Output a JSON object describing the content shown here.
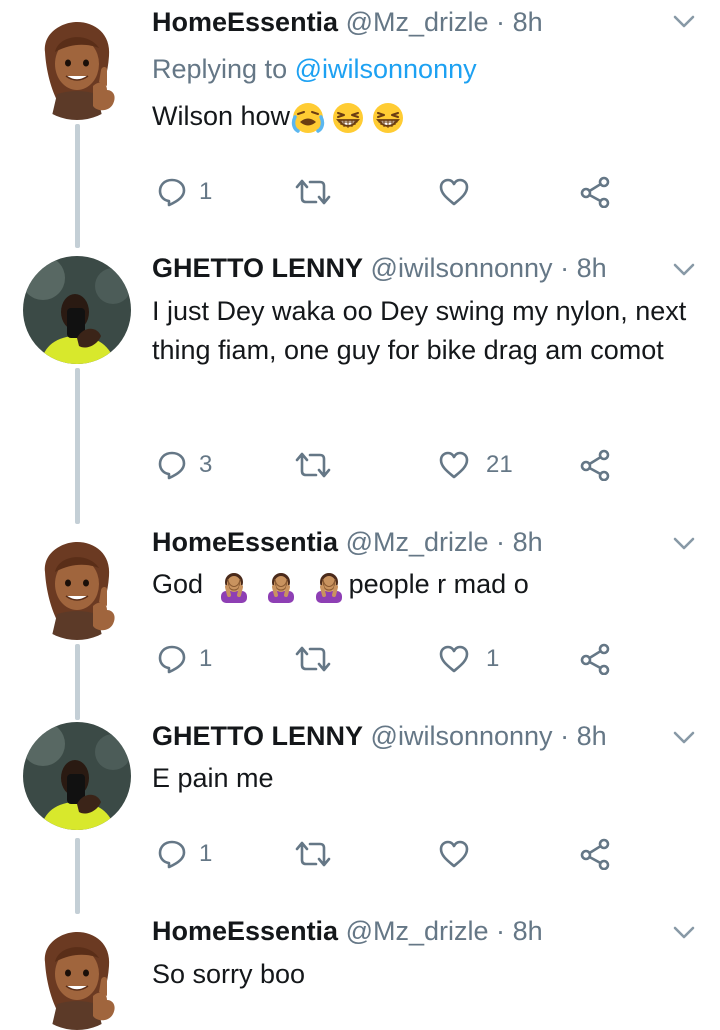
{
  "tweets": [
    {
      "name": "HomeEssentia",
      "handle": "@Mz_drizle",
      "separator": "·",
      "time": "8h",
      "reply_prefix": "Replying to",
      "reply_mention": "@iwilsonnonny",
      "text": "Wilson how",
      "emojis": [
        "tears-of-joy-crying-emoji",
        "grinning-squint-emoji",
        "grinning-squint-emoji"
      ],
      "reply_count": "1",
      "retweet_count": "",
      "like_count": ""
    },
    {
      "name": "GHETTO LENNY",
      "handle": "@iwilsonnonny",
      "separator": "·",
      "time": "8h",
      "text": "I just Dey waka oo Dey swing my nylon, next thing fiam, one guy for bike drag am comot",
      "reply_count": "3",
      "retweet_count": "",
      "like_count": "21"
    },
    {
      "name": "HomeEssentia",
      "handle": "@Mz_drizle",
      "separator": "·",
      "time": "8h",
      "text_before": "God",
      "text_after": "people r mad o",
      "emojis": [
        "facepalm-emoji",
        "facepalm-emoji",
        "facepalm-emoji"
      ],
      "reply_count": "1",
      "retweet_count": "",
      "like_count": "1"
    },
    {
      "name": "GHETTO LENNY",
      "handle": "@iwilsonnonny",
      "separator": "·",
      "time": "8h",
      "text": "E pain me",
      "reply_count": "1",
      "retweet_count": "",
      "like_count": ""
    },
    {
      "name": "HomeEssentia",
      "handle": "@Mz_drizle",
      "separator": "·",
      "time": "8h",
      "text": "So sorry boo"
    }
  ],
  "icons": {
    "reply": "reply-icon",
    "retweet": "retweet-icon",
    "like": "heart-icon",
    "share": "share-icon",
    "more": "chevron-down-icon"
  },
  "colors": {
    "name": "#14171a",
    "meta": "#657786",
    "mention": "#1da1f2",
    "thread_line": "#c4cfd6",
    "icon": "#657786"
  }
}
